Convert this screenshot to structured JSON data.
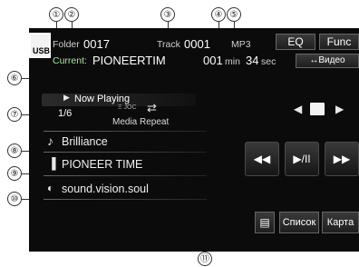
{
  "callouts": [
    "①",
    "②",
    "③",
    "④",
    "⑤",
    "⑥",
    "⑦",
    "⑧",
    "⑨",
    "⑩",
    "⑪"
  ],
  "source": {
    "label": "USB"
  },
  "info_bar": {
    "folder_label": "Folder",
    "folder_value": "0017",
    "track_label": "Track",
    "track_value": "0001",
    "format": "MP3",
    "current_label": "Current:",
    "current_file": "PIONEERTIM",
    "time_min": "001",
    "min_label": "min",
    "time_sec": "34",
    "sec_label": "sec"
  },
  "buttons": {
    "eq": "EQ",
    "func": "Func",
    "video": "↔Видео",
    "list": "Список",
    "map": "Карта"
  },
  "now_playing": {
    "header": "Now Playing",
    "counter": "1/6",
    "repeat_mode": "Media Repeat",
    "repeat_tags": "Ξ JOC"
  },
  "track_info": {
    "title": "Brilliance",
    "artist": "PIONEER TIME",
    "album": "sound.vision.soul"
  },
  "icons": {
    "usb": "usb-icon",
    "play_small": "play-small-icon",
    "repeat": "repeat-icon",
    "music_note": "music-note-icon",
    "artist": "person-icon",
    "album": "disc-icon",
    "prev_folder": "arrow-left-icon",
    "folder": "folder-icon",
    "next_folder": "arrow-right-icon",
    "prev_track": "skip-previous-icon",
    "play_pause": "play-pause-icon",
    "next_track": "skip-next-icon",
    "list": "list-icon"
  }
}
